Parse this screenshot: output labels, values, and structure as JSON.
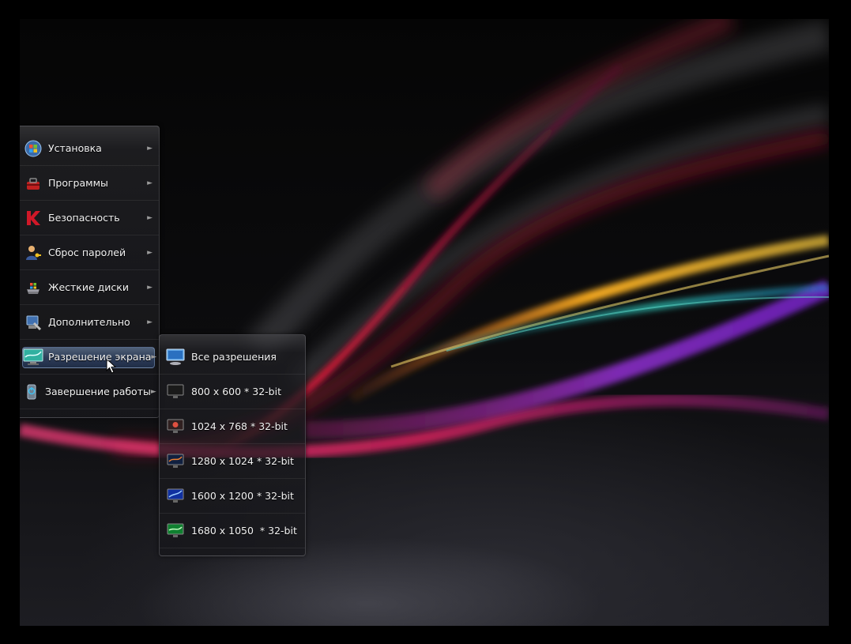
{
  "menu": {
    "items": [
      {
        "label": "Установка",
        "icon": "windows-orb-icon"
      },
      {
        "label": "Программы",
        "icon": "toolbox-icon"
      },
      {
        "label": "Безопасность",
        "icon": "kaspersky-icon"
      },
      {
        "label": "Сброс паролей",
        "icon": "user-key-icon"
      },
      {
        "label": "Жесткие диски",
        "icon": "hard-disk-icon"
      },
      {
        "label": "Дополнительно",
        "icon": "tools-icon"
      },
      {
        "label": "Разрешение экрана",
        "icon": "monitor-icon",
        "active": true
      },
      {
        "label": "Завершение работы",
        "icon": "shutdown-icon"
      }
    ],
    "arrow": "►"
  },
  "submenu": {
    "items": [
      {
        "label": "Все разрешения",
        "icon": "monitor-icon"
      },
      {
        "label": "800 x 600 * 32-bit",
        "icon": "monitor-icon"
      },
      {
        "label": "1024 x 768 * 32-bit",
        "icon": "monitor-icon"
      },
      {
        "label": "1280 x 1024 * 32-bit",
        "icon": "monitor-icon"
      },
      {
        "label": "1600 x 1200 * 32-bit",
        "icon": "monitor-icon"
      },
      {
        "label": "1680 x 1050  * 32-bit",
        "icon": "monitor-icon"
      }
    ]
  },
  "colors": {
    "highlight": "#5a82b8",
    "text": "#f2f2f2",
    "wave_red": "#e0203a",
    "wave_orange": "#f0a020",
    "wave_teal": "#30c0b0",
    "wave_purple": "#8030c0"
  }
}
